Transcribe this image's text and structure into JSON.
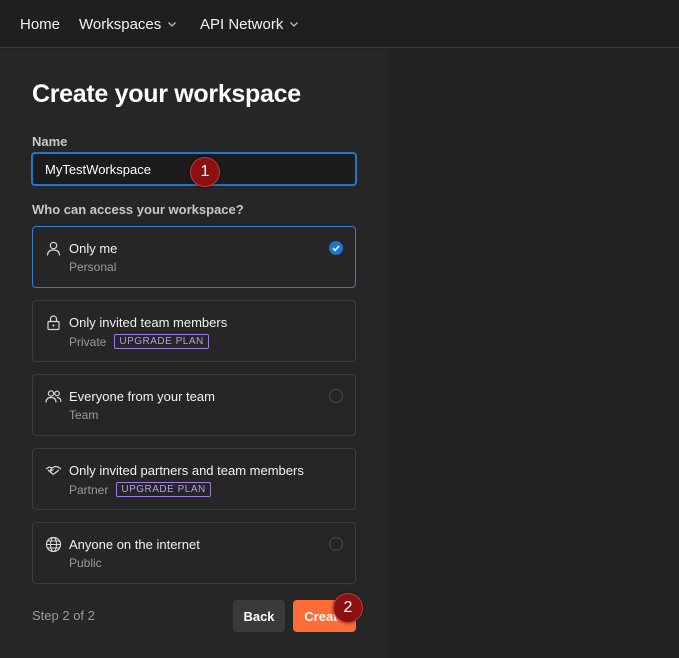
{
  "nav": {
    "items": [
      {
        "label": "Home"
      },
      {
        "label": "Workspaces"
      },
      {
        "label": "API Network"
      }
    ]
  },
  "form": {
    "title": "Create your workspace",
    "name_label": "Name",
    "name_value": "MyTestWorkspace",
    "access_label": "Who can access your workspace?",
    "options": [
      {
        "title": "Only me",
        "subtitle": "Personal",
        "icon": "person-icon",
        "selected": true
      },
      {
        "title": "Only invited team members",
        "subtitle": "Private",
        "badge": "UPGRADE PLAN",
        "icon": "lock-icon"
      },
      {
        "title": "Everyone from your team",
        "subtitle": "Team",
        "icon": "team-icon"
      },
      {
        "title": "Only invited partners and team members",
        "subtitle": "Partner",
        "badge": "UPGRADE PLAN",
        "icon": "handshake-icon"
      },
      {
        "title": "Anyone on the internet",
        "subtitle": "Public",
        "icon": "globe-icon"
      }
    ],
    "step": "Step 2 of 2",
    "back_label": "Back",
    "create_label": "Create"
  },
  "annotations": {
    "marker1": "1",
    "marker2": "2"
  },
  "colors": {
    "accent": "#ff6c37",
    "focus": "#1d77d1",
    "badge": "#a07be0",
    "marker": "#8b1010"
  }
}
